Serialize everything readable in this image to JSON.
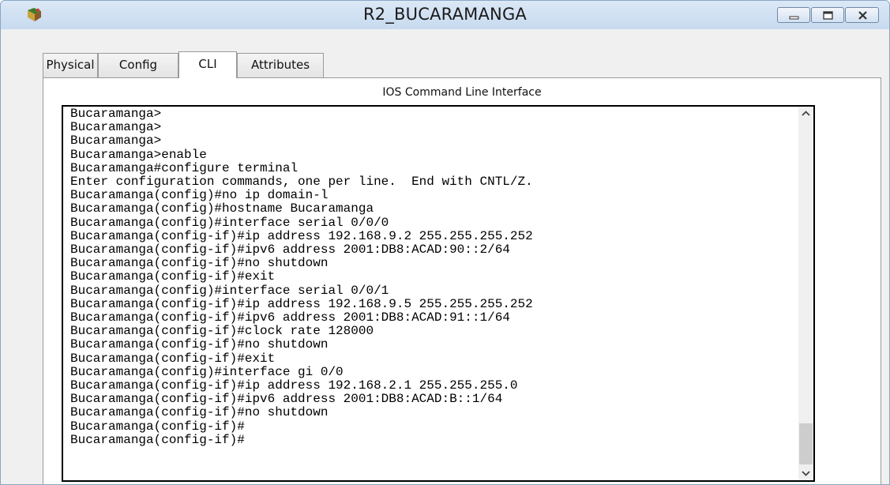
{
  "window": {
    "title": "R2_BUCARAMANGA"
  },
  "tabs": [
    {
      "label": "Physical",
      "active": false
    },
    {
      "label": "Config",
      "active": false
    },
    {
      "label": "CLI",
      "active": true
    },
    {
      "label": "Attributes",
      "active": false
    }
  ],
  "panel": {
    "title": "IOS Command Line Interface"
  },
  "cli": {
    "lines": [
      "Bucaramanga>",
      "Bucaramanga>",
      "Bucaramanga>",
      "Bucaramanga>enable",
      "Bucaramanga#configure terminal",
      "Enter configuration commands, one per line.  End with CNTL/Z.",
      "Bucaramanga(config)#no ip domain-l",
      "Bucaramanga(config)#hostname Bucaramanga",
      "Bucaramanga(config)#interface serial 0/0/0",
      "Bucaramanga(config-if)#ip address 192.168.9.2 255.255.255.252",
      "Bucaramanga(config-if)#ipv6 address 2001:DB8:ACAD:90::2/64",
      "Bucaramanga(config-if)#no shutdown",
      "Bucaramanga(config-if)#exit",
      "Bucaramanga(config)#interface serial 0/0/1",
      "Bucaramanga(config-if)#ip address 192.168.9.5 255.255.255.252",
      "Bucaramanga(config-if)#ipv6 address 2001:DB8:ACAD:91::1/64",
      "Bucaramanga(config-if)#clock rate 128000",
      "Bucaramanga(config-if)#no shutdown",
      "Bucaramanga(config-if)#exit",
      "Bucaramanga(config)#interface gi 0/0",
      "Bucaramanga(config-if)#ip address 192.168.2.1 255.255.255.0",
      "Bucaramanga(config-if)#ipv6 address 2001:DB8:ACAD:B::1/64",
      "Bucaramanga(config-if)#no shutdown",
      "Bucaramanga(config-if)#",
      "Bucaramanga(config-if)#"
    ]
  },
  "icons": {
    "app": "packet-tracer-router-icon",
    "minimize": "minimize-icon",
    "maximize": "maximize-icon",
    "close": "close-icon",
    "scroll_up": "chevron-up-icon",
    "scroll_down": "chevron-down-icon"
  },
  "colors": {
    "titlebar": "#c9dcef",
    "terminal_bg": "#ffffff",
    "terminal_text": "#000000"
  }
}
